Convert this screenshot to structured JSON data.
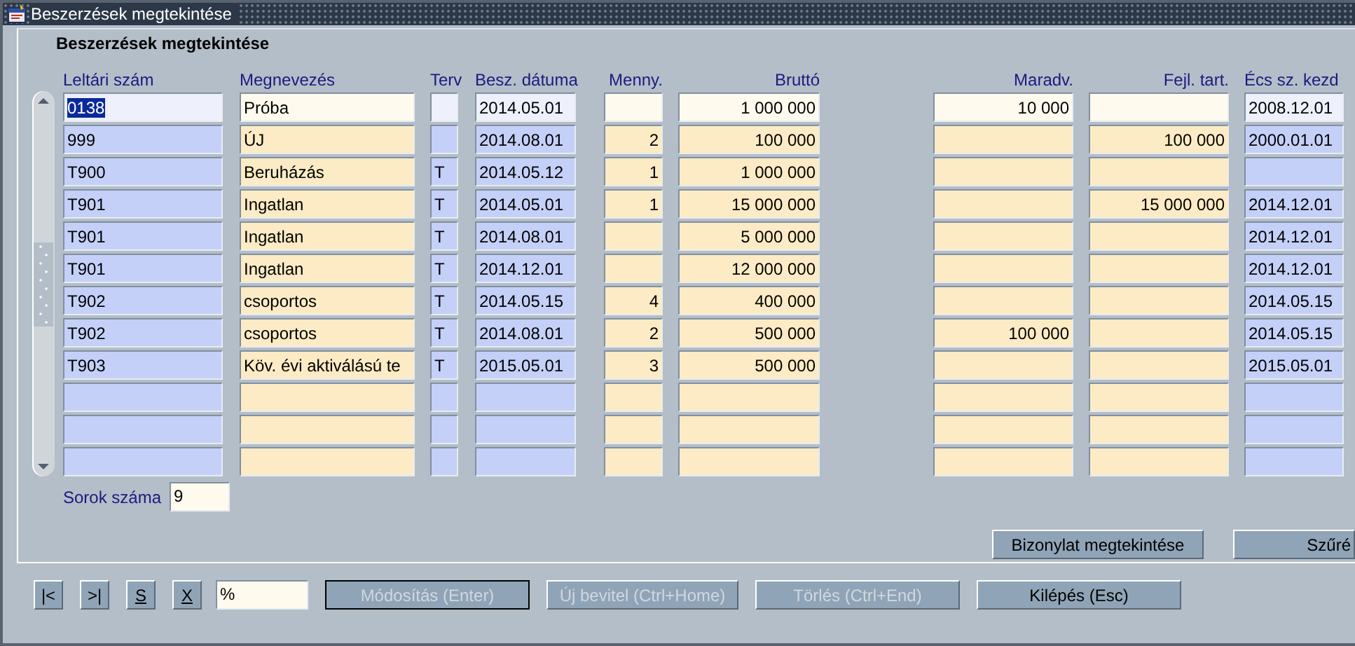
{
  "window": {
    "title": "Beszerzések megtekintése"
  },
  "form_title": "Beszerzések megtekintése",
  "columns": [
    "Leltári szám",
    "Megnevezés",
    "Terv",
    "Besz. dátuma",
    "Menny.",
    "Bruttó",
    "Maradv.",
    "Fejl. tart.",
    "Écs sz. kezd"
  ],
  "rows": [
    {
      "selected": true,
      "cells": [
        "0138",
        "Próba",
        null,
        "2014.05.01",
        null,
        "1 000 000",
        "10 000",
        null,
        "2008.12.01"
      ]
    },
    {
      "selected": false,
      "cells": [
        "999",
        "ÚJ",
        null,
        "2014.08.01",
        "2",
        "100 000",
        null,
        "100 000",
        "2000.01.01"
      ]
    },
    {
      "selected": false,
      "cells": [
        "T900",
        "Beruházás",
        "T",
        "2014.05.12",
        "1",
        "1 000 000",
        null,
        null,
        null
      ]
    },
    {
      "selected": false,
      "cells": [
        "T901",
        "Ingatlan",
        "T",
        "2014.05.01",
        "1",
        "15 000 000",
        null,
        "15 000 000",
        "2014.12.01"
      ]
    },
    {
      "selected": false,
      "cells": [
        "T901",
        "Ingatlan",
        "T",
        "2014.08.01",
        null,
        "5 000 000",
        null,
        null,
        "2014.12.01"
      ]
    },
    {
      "selected": false,
      "cells": [
        "T901",
        "Ingatlan",
        "T",
        "2014.12.01",
        null,
        "12 000 000",
        null,
        null,
        "2014.12.01"
      ]
    },
    {
      "selected": false,
      "cells": [
        "T902",
        "csoportos",
        "T",
        "2014.05.15",
        "4",
        "400 000",
        null,
        null,
        "2014.05.15"
      ]
    },
    {
      "selected": false,
      "cells": [
        "T902",
        "csoportos",
        "T",
        "2014.08.01",
        "2",
        "500 000",
        "100 000",
        null,
        "2014.05.15"
      ]
    },
    {
      "selected": false,
      "cells": [
        "T903",
        "Köv. évi aktiválású te",
        "T",
        "2015.05.01",
        "3",
        "500 000",
        null,
        null,
        "2015.05.01"
      ]
    },
    {
      "selected": false,
      "cells": [
        null,
        null,
        null,
        null,
        null,
        null,
        null,
        null,
        null
      ]
    },
    {
      "selected": false,
      "cells": [
        null,
        null,
        null,
        null,
        null,
        null,
        null,
        null,
        null
      ]
    },
    {
      "selected": false,
      "cells": [
        null,
        null,
        null,
        null,
        null,
        null,
        null,
        null,
        null
      ]
    }
  ],
  "row_count": {
    "label": "Sorok száma",
    "value": "9"
  },
  "form_buttons": [
    {
      "label": "Bizonylat megtekintése",
      "disabled": false
    },
    {
      "label": "Szűré",
      "disabled": false
    }
  ],
  "nav_buttons": [
    {
      "label": "|<",
      "underlined": false
    },
    {
      "label": ">|",
      "underlined": false
    },
    {
      "label": "S",
      "underlined": true
    },
    {
      "label": "X",
      "underlined": true
    }
  ],
  "query_field": {
    "value": "%"
  },
  "action_buttons": [
    {
      "label": "Módosítás (Enter)",
      "disabled": true,
      "default": true
    },
    {
      "label": "Új bevitel (Ctrl+Home)",
      "disabled": true,
      "default": false
    },
    {
      "label": "Törlés (Ctrl+End)",
      "disabled": true,
      "default": false
    },
    {
      "label": "Kilépés (Esc)",
      "disabled": false,
      "default": false
    }
  ]
}
